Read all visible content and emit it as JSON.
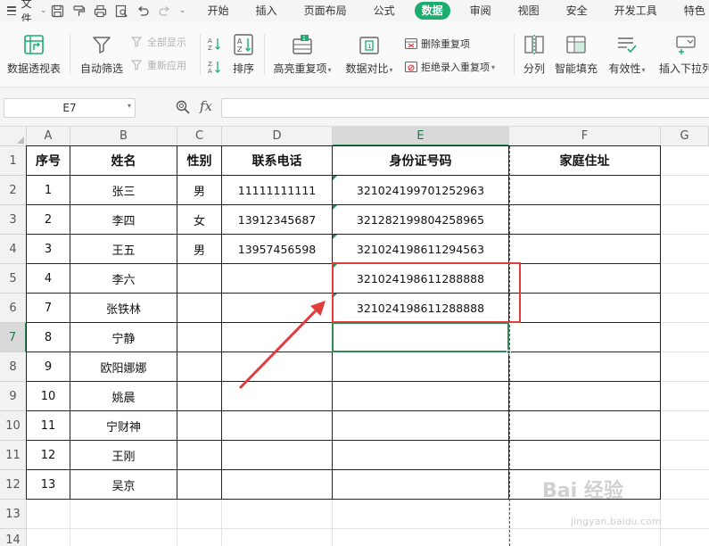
{
  "menubar": {
    "file_label": "文件",
    "tabs": [
      {
        "label": "开始",
        "active": false
      },
      {
        "label": "插入",
        "active": false
      },
      {
        "label": "页面布局",
        "active": false
      },
      {
        "label": "公式",
        "active": false
      },
      {
        "label": "数据",
        "active": true
      },
      {
        "label": "审阅",
        "active": false
      },
      {
        "label": "视图",
        "active": false
      },
      {
        "label": "安全",
        "active": false
      },
      {
        "label": "开发工具",
        "active": false
      },
      {
        "label": "特色",
        "active": false
      }
    ]
  },
  "ribbon": {
    "pivot_table": "数据透视表",
    "auto_filter": "自动筛选",
    "show_all": "全部显示",
    "reapply": "重新应用",
    "sort": "排序",
    "highlight_dup": "高亮重复项",
    "data_compare": "数据对比",
    "remove_dup": "删除重复项",
    "reject_dup": "拒绝录入重复项",
    "split": "分列",
    "smart_fill": "智能填充",
    "validity": "有效性",
    "insert_dropdown": "插入下拉列"
  },
  "formula_bar": {
    "name_box": "E7",
    "fx_label": "fx",
    "formula": ""
  },
  "grid": {
    "column_letters": [
      "A",
      "B",
      "C",
      "D",
      "E",
      "F",
      "G"
    ],
    "row_numbers": [
      "1",
      "2",
      "3",
      "4",
      "5",
      "6",
      "7",
      "8",
      "9",
      "10",
      "11",
      "12",
      "13",
      "14"
    ],
    "selected_cell": "E7",
    "headers": [
      "序号",
      "姓名",
      "性别",
      "联系电话",
      "身份证号码",
      "家庭住址"
    ],
    "rows": [
      [
        "1",
        "张三",
        "男",
        "11111111111",
        "321024199701252963",
        ""
      ],
      [
        "2",
        "李四",
        "女",
        "13912345687",
        "321282199804258965",
        ""
      ],
      [
        "3",
        "王五",
        "男",
        "13957456598",
        "321024198611294563",
        ""
      ],
      [
        "4",
        "李六",
        "",
        "",
        "321024198611288888",
        ""
      ],
      [
        "7",
        "张铁林",
        "",
        "",
        "321024198611288888",
        ""
      ],
      [
        "8",
        "宁静",
        "",
        "",
        "",
        ""
      ],
      [
        "9",
        "欧阳娜娜",
        "",
        "",
        "",
        ""
      ],
      [
        "10",
        "姚晨",
        "",
        "",
        "",
        ""
      ],
      [
        "11",
        "宁财神",
        "",
        "",
        "",
        ""
      ],
      [
        "12",
        "王刚",
        "",
        "",
        "",
        ""
      ],
      [
        "13",
        "吴京",
        "",
        "",
        "",
        ""
      ]
    ]
  },
  "watermark": {
    "brand": "Bai 经验",
    "url": "jingyan.baidu.com"
  },
  "colors": {
    "accent": "#1aad6e",
    "selection": "#2e8b57",
    "highlight_box": "#e03c3c",
    "arrow": "#e03c3c"
  }
}
